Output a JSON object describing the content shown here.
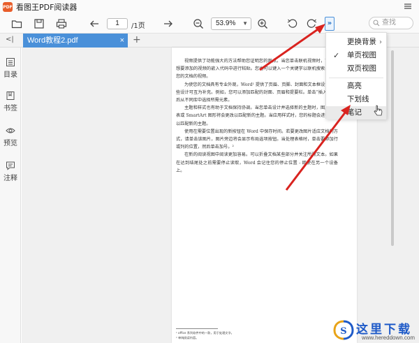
{
  "app": {
    "title": "看图王PDF阅读器",
    "logo_text": "PDF"
  },
  "toolbar": {
    "page_current": "1",
    "page_total": "/1页",
    "zoom": "53.9%",
    "more": "»",
    "search_placeholder": "查找"
  },
  "tabs": [
    {
      "label": "Word教程2.pdf",
      "close": "×"
    }
  ],
  "tab_add": "+",
  "collapse": "<|",
  "sidebar": [
    {
      "label": "目录",
      "icon": "list-icon"
    },
    {
      "label": "书签",
      "icon": "bookmark-icon"
    },
    {
      "label": "预览",
      "icon": "eye-icon"
    },
    {
      "label": "注释",
      "icon": "comment-icon"
    }
  ],
  "dropdown": {
    "items": [
      {
        "label": "更换背景",
        "submenu": true
      },
      {
        "label": "单页视图",
        "checked": true
      },
      {
        "label": "双页视图"
      },
      {
        "label": "高亮"
      },
      {
        "label": "下划线"
      },
      {
        "label": "笔记",
        "hover": true
      }
    ],
    "check": "✓",
    "submenu_arrow": "›"
  },
  "document": {
    "paragraphs": [
      "视频提供了功能强大的方法帮助您证明您的观点。当您单击联机视频时，可以在想要添加的视频的嵌入代码中进行粘贴。您也可以键入一个关键字以联机搜索最适合您的文档的视频。",
      "为使您的文档具有专业外观，Word¹ 提供了页眉、页脚、封面和文本框设计，这些设计可互为补充。例如，您可以添加匹配的封面、页眉和提要栏。单击“插入”，然后从不同库中选择所需元素。",
      "主题和样式也有助于文档保持协调。当您单击设计并选择新的主题时，图片、图表或 SmartArt 图形将会更改以匹配新的主题。当应用样式时，您的标题会进行更改以匹配新的主题。",
      "使用在需要位置出现的新按钮在 Word 中保存时间。若要更改图片适应文档的方式，请单击该图片，图片旁边将会显示布局选项按钮。当处理表格时，单击要添加行或列的位置，然后单击加号。²",
      "在新的阅读视图中阅读更加容易。可以折叠文档某些部分并关注所需文本。如果在达到结尾处之前需要停止读取，Word 会记住您的停止位置 - 即使在另一个设备上。"
    ],
    "footnotes": [
      "¹ office 系列软件中的一款，用于处理文字。",
      "² 单纯阅读内容。"
    ]
  },
  "watermark": {
    "text": "这里下载",
    "url": "www.hereddown.com"
  },
  "colors": {
    "accent": "#4a90d9",
    "arrow": "#d9231f",
    "watermark": "#1e5ac8"
  }
}
